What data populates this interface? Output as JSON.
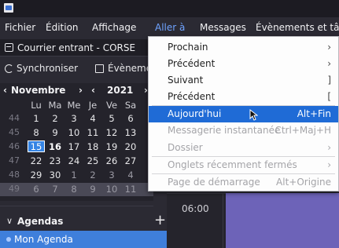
{
  "menubar": {
    "items": [
      {
        "label": "Fichier"
      },
      {
        "label": "Édition"
      },
      {
        "label": "Affichage"
      },
      {
        "label": "Aller à"
      },
      {
        "label": "Messages"
      },
      {
        "label": "Évènements et tâc"
      }
    ]
  },
  "tab": {
    "label": "Courrier entrant - CORSE"
  },
  "toolbar": {
    "sync_label": "Synchroniser",
    "events_label": "Évènemen"
  },
  "minical": {
    "month": "Novembre",
    "year": "2021",
    "weekdays": [
      "Lu",
      "Ma",
      "Me",
      "Je",
      "Ve",
      "Sa"
    ],
    "weeks": [
      {
        "num": "44",
        "days": [
          "1",
          "2",
          "3",
          "4",
          "5",
          "6"
        ]
      },
      {
        "num": "45",
        "days": [
          "8",
          "9",
          "10",
          "11",
          "12",
          "13"
        ]
      },
      {
        "num": "46",
        "days": [
          "15",
          "16",
          "17",
          "18",
          "19",
          "20"
        ]
      },
      {
        "num": "47",
        "days": [
          "22",
          "23",
          "24",
          "25",
          "26",
          "27"
        ]
      },
      {
        "num": "48",
        "days": [
          "29",
          "30",
          "1",
          "2",
          "3",
          "4"
        ]
      },
      {
        "num": "49",
        "days": [
          "6",
          "7",
          "8",
          "9",
          "10",
          "11"
        ]
      }
    ]
  },
  "agendas": {
    "header": "Agendas",
    "items": [
      {
        "label": "Mon Agenda"
      }
    ]
  },
  "calview": {
    "time": "06:00"
  },
  "dropdown": {
    "items": [
      {
        "label": "Prochain",
        "right": "›"
      },
      {
        "label": "Précédent",
        "right": "›"
      },
      {
        "label": "Suivant",
        "right": "]"
      },
      {
        "label": "Précédent",
        "right": "["
      },
      {
        "label": "Aujourd'hui",
        "right": "Alt+Fin"
      },
      {
        "label": "Messagerie instantanée",
        "right": "Ctrl+Maj+H"
      },
      {
        "label": "Dossier",
        "right": "›"
      },
      {
        "label": "Onglets récemment fermés",
        "right": "›"
      },
      {
        "label": "Page de démarrage",
        "right": "Alt+Origine"
      }
    ]
  },
  "colors": {
    "accent": "#1f6bd6",
    "selection": "#3f7fdb",
    "event": "#6d63b8"
  }
}
